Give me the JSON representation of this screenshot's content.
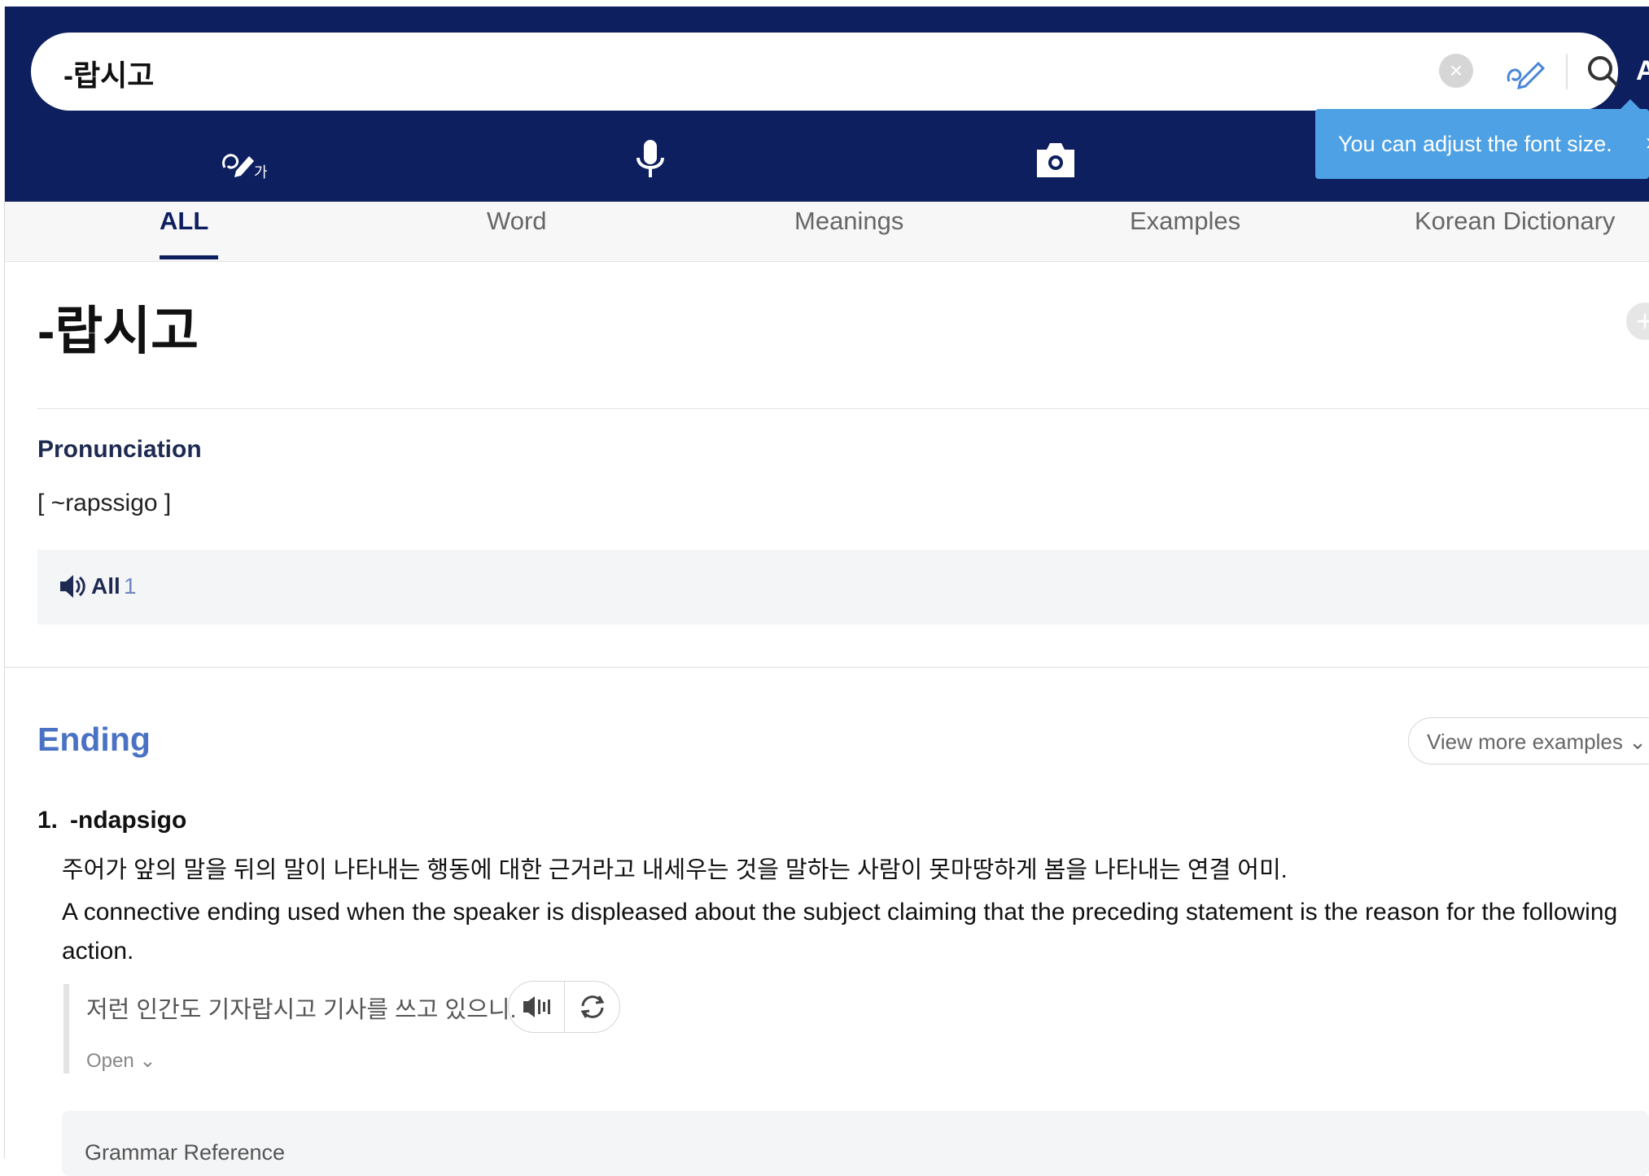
{
  "search": {
    "query": "-랍시고",
    "clear_icon": "x-circle-icon",
    "handwriting_icon": "pen-hand-icon",
    "search_icon": "magnifier-icon",
    "font_button_label": "A"
  },
  "tools": [
    {
      "name": "handwriting-input",
      "icon": "hand-pen-ga-icon"
    },
    {
      "name": "voice-input",
      "icon": "microphone-icon"
    },
    {
      "name": "image-input",
      "icon": "camera-icon"
    }
  ],
  "tooltip": {
    "text": "You can adjust the font size.",
    "close_icon": "chevron-right-icon"
  },
  "tabs": [
    {
      "label": "ALL",
      "active": true
    },
    {
      "label": "Word",
      "active": false
    },
    {
      "label": "Meanings",
      "active": false
    },
    {
      "label": "Examples",
      "active": false
    },
    {
      "label": "Korean Dictionary",
      "active": false
    }
  ],
  "entry": {
    "headword": "-랍시고",
    "add_icon": "plus-circle-icon",
    "pronunciation_title": "Pronunciation",
    "pronunciation": "[ ~rapssigo ]",
    "audio": {
      "label": "All",
      "count": "1",
      "icon": "speaker-icon"
    }
  },
  "section": {
    "title": "Ending",
    "view_more": "View more examples",
    "definitions": [
      {
        "number": "1.",
        "word": "-ndapsigo",
        "korean": "주어가 앞의 말을 뒤의 말이 나타내는 행동에 대한 근거라고 내세우는 것을 말하는 사람이 못마땅하게 봄을 나타내는 연결 어미.",
        "english": "A connective ending used when the speaker is displeased about the subject claiming that the preceding statement is the reason for the following action.",
        "example": "저런 인간도 기자랍시고 기사를 쓰고 있으니.",
        "open_label": "Open"
      }
    ],
    "grammar_reference": "Grammar Reference"
  },
  "colors": {
    "header_bg": "#0d1f5e",
    "accent_blue": "#4a72c4",
    "tooltip_bg": "#4ea1e4"
  }
}
